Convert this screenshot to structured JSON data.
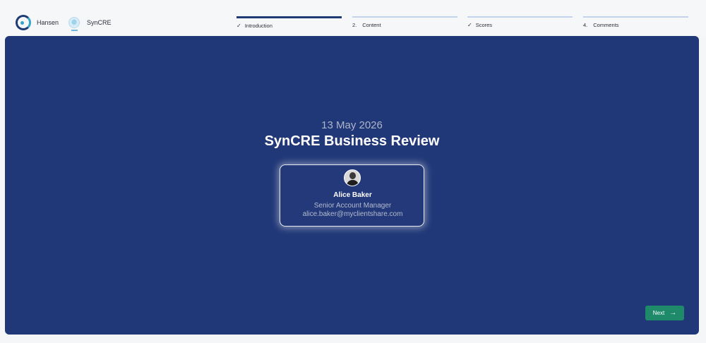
{
  "header": {
    "brand_1": "Hansen",
    "brand_2": "SynCRE"
  },
  "steps": [
    {
      "label": "Introduction",
      "marker": "✓",
      "status": "current"
    },
    {
      "label": "Content",
      "marker": "2.",
      "status": "pending"
    },
    {
      "label": "Scores",
      "marker": "✓",
      "status": "completed"
    },
    {
      "label": "Comments",
      "marker": "4.",
      "status": "pending"
    }
  ],
  "main": {
    "date": "13 May 2026",
    "title": "SynCRE Business Review",
    "contact": {
      "name": "Alice Baker",
      "role": "Senior Account Manager",
      "email": "alice.baker@myclientshare.com"
    },
    "next_label": "Next"
  },
  "colors": {
    "panel": "#213878",
    "step_active": "#1f3b73",
    "step_inactive": "#c4d3ec",
    "next_button": "#1f8a6a"
  }
}
